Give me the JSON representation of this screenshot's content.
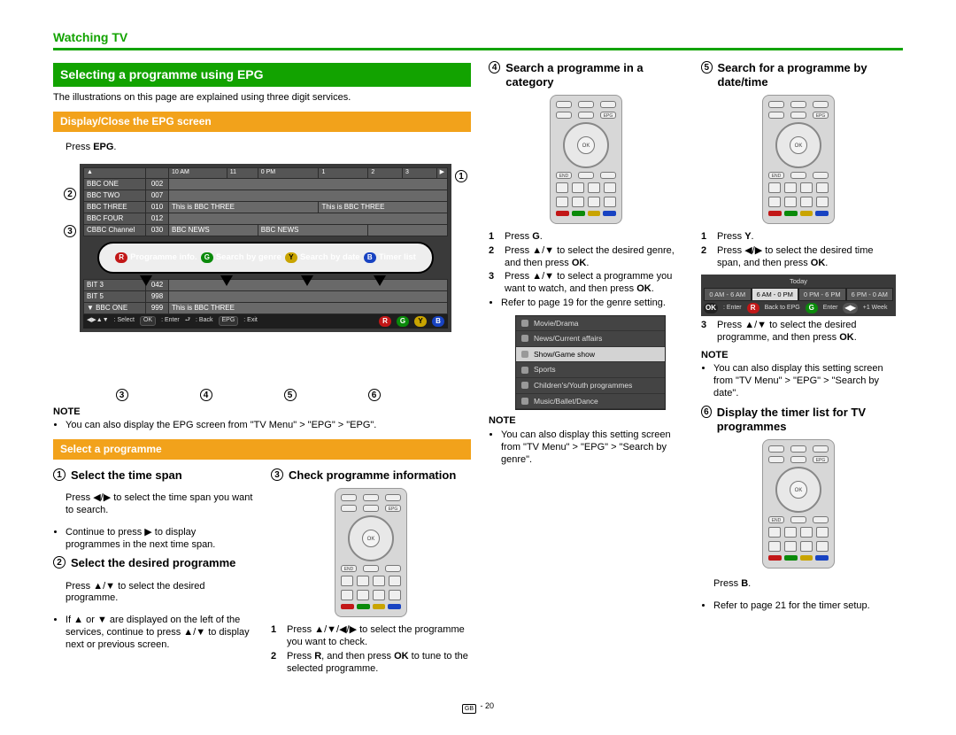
{
  "header": {
    "title": "Watching TV"
  },
  "section": {
    "bar1": "Selecting a programme using EPG",
    "intro": "The illustrations on this page are explained using three digit services.",
    "bar2": "Display/Close the EPG screen",
    "pressEpg_a": "Press ",
    "pressEpg_b": "EPG",
    "pressEpg_c": ".",
    "note1_head": "NOTE",
    "note1_item": "You can also display the EPG screen from \"TV Menu\" > \"EPG\" > \"EPG\".",
    "bar3": "Select a programme"
  },
  "epg": {
    "timebar": [
      "10 AM",
      "11",
      "0 PM",
      "1",
      "2",
      "3"
    ],
    "rows": [
      {
        "ch": "BBC ONE",
        "n": "002",
        "progs": []
      },
      {
        "ch": "BBC TWO",
        "n": "007",
        "progs": []
      },
      {
        "ch": "BBC THREE",
        "n": "010",
        "progs": [
          "This is BBC THREE",
          "",
          "This is BBC THREE"
        ]
      },
      {
        "ch": "BBC FOUR",
        "n": "012",
        "progs": []
      },
      {
        "ch": "CBBC Channel",
        "n": "030",
        "progs": [
          "BBC NEWS",
          "",
          "BBC NEWS"
        ]
      }
    ],
    "bubble": [
      {
        "color": "red",
        "letter": "R",
        "label": "Programme info."
      },
      {
        "color": "green",
        "letter": "G",
        "label": "Search by genre"
      },
      {
        "color": "yellow",
        "letter": "Y",
        "label": "Search by date"
      },
      {
        "color": "blue",
        "letter": "B",
        "label": "Timer list"
      }
    ],
    "after_bubble": [
      "③",
      "④",
      "⑤",
      "⑥"
    ],
    "bottom_channels": [
      {
        "ch": "BIT 3",
        "n": "042"
      },
      {
        "ch": "BIT 5",
        "n": "998"
      },
      {
        "ch": "BBC ONE",
        "n": "999",
        "prog": "This is BBC THREE"
      }
    ],
    "bottombar": {
      "select": ": Select",
      "enter": ": Enter",
      "back": ": Back",
      "exit": ": Exit",
      "keys": [
        "OK",
        "EPG"
      ]
    },
    "callouts_right": [
      "①",
      "②",
      "③",
      "④",
      "⑤",
      "⑥"
    ]
  },
  "steps": {
    "s1_title": "Select the time span",
    "s1_body_a": "Press ",
    "s1_body_b": " to select the time span you want to search.",
    "s1_bullet_a": "Continue to press ",
    "s1_bullet_b": " to display programmes in the next time span.",
    "s2_title": "Select the desired programme",
    "s2_body_a": "Press ",
    "s2_body_b": " to select the desired programme.",
    "s2_bullet_a": "If ",
    "s2_bullet_b": " or ",
    "s2_bullet_c": " are displayed on the left of the services, continue to press ",
    "s2_bullet_d": " to display next or previous screen.",
    "s3_title": "Check programme information",
    "s3_n1_a": "Press ",
    "s3_n1_b": " to select the programme you want to check.",
    "s3_n2_a": "Press ",
    "s3_n2_b": "R",
    "s3_n2_c": ", and then press ",
    "s3_n2_d": "OK",
    "s3_n2_e": " to tune to the selected programme.",
    "s4_title": "Search a programme in a category",
    "s4_n1_a": "Press ",
    "s4_n1_b": "G",
    "s4_n1_c": ".",
    "s4_n2_a": "Press ",
    "s4_n2_b": " to select the desired genre, and then press ",
    "s4_n2_c": "OK",
    "s4_n2_d": ".",
    "s4_n3_a": "Press ",
    "s4_n3_b": " to select a programme you want to watch, and then press ",
    "s4_n3_c": "OK",
    "s4_n3_d": ".",
    "s4_sub": "Refer to page 19 for the genre setting.",
    "s4_note_head": "NOTE",
    "s4_note": "You can also display this setting screen from \"TV Menu\" > \"EPG\" > \"Search by genre\".",
    "s5_title": "Search for a programme by date/time",
    "s5_n1_a": "Press ",
    "s5_n1_b": "Y",
    "s5_n1_c": ".",
    "s5_n2_a": "Press ",
    "s5_n2_b": " to select the desired time span, and then press ",
    "s5_n2_c": "OK",
    "s5_n2_d": ".",
    "s5_n3_a": "Press ",
    "s5_n3_b": " to select the desired programme, and then press ",
    "s5_n3_c": "OK",
    "s5_n3_d": ".",
    "s5_note_head": "NOTE",
    "s5_note": "You can also display this setting screen from \"TV Menu\" > \"EPG\" > \"Search by date\".",
    "s6_title": "Display the timer list for TV programmes",
    "s6_body_a": "Press ",
    "s6_body_b": "B",
    "s6_body_c": ".",
    "s6_sub": "Refer to page 21 for the timer setup."
  },
  "genre_menu": [
    "Movie/Drama",
    "News/Current affairs",
    "Show/Game show",
    "Sports",
    "Children's/Youth programmes",
    "Music/Ballet/Dance"
  ],
  "date_strip": {
    "today": "Today",
    "cells": [
      "0 AM - 6 AM",
      "6 AM - 0 PM",
      "0 PM - 6 PM",
      "6 PM - 0 AM"
    ],
    "active_index": 1,
    "keys": {
      "ok": "OK",
      "enter": ": Enter",
      "back_pill": "R",
      "back": "Back to EPG",
      "entpill": "G",
      "ent": "Enter",
      "wk_icon": "◀▶",
      "wk": "+1 Week"
    }
  },
  "footer": {
    "gb": "GB",
    "page": "20"
  }
}
